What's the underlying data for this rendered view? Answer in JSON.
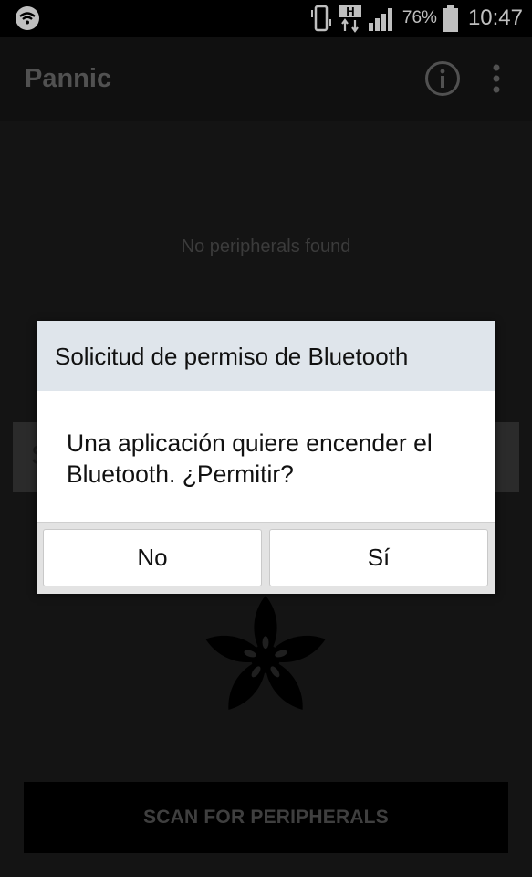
{
  "status_bar": {
    "battery_percent": "76%",
    "time": "10:47",
    "network_type": "H",
    "icons": [
      "wifi-icon",
      "vibrate-icon",
      "hspa-data-icon",
      "signal-icon",
      "battery-icon"
    ]
  },
  "app_bar": {
    "title": "Pannic",
    "info_icon": "info-icon",
    "more_icon": "more-vert-icon"
  },
  "main": {
    "empty_text": "No peripherals found",
    "scan_button_label": "SCAN FOR PERIPHERALS",
    "obscured_button_initial": "S",
    "logo_icon": "adafruit-flower-logo"
  },
  "dialog": {
    "title": "Solicitud de permiso de Bluetooth",
    "message": "Una aplicación quiere encender el Bluetooth. ¿Permitir?",
    "buttons": {
      "no": "No",
      "yes": "Sí"
    }
  },
  "colors": {
    "status_bar_bg": "#000000",
    "app_bar_bg": "#161616",
    "content_bg": "#1b1b1b",
    "dialog_title_bg": "#dfe5eb",
    "dialog_bg": "#ffffff",
    "dim_text": "#4f4f4f"
  }
}
